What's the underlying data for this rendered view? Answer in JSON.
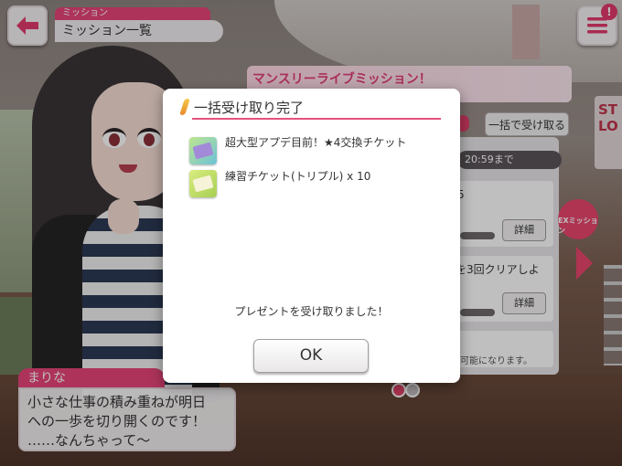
{
  "header": {
    "section_tag": "ミッション",
    "title": "ミッション一覧"
  },
  "menu_badge": "!",
  "mission_panel": {
    "banner": "マンスリーライブミッション！",
    "collect_all": "一括で受け取る",
    "deadline": "20:59まで",
    "cards": [
      {
        "text": "5",
        "detail": "詳細"
      },
      {
        "text": "を3回クリアしよ",
        "detail": "詳細"
      },
      {
        "text": "可能になります。",
        "detail": ""
      }
    ],
    "ex_label": "EXミッション"
  },
  "speech": {
    "speaker": "まりな",
    "lines": [
      "小さな仕事の積み重ねが明日",
      "への一歩を切り開くのです！",
      "……なんちゃって〜"
    ]
  },
  "modal": {
    "title": "一括受け取り完了",
    "rewards": [
      {
        "label": "超大型アプデ目前！★4交換チケット",
        "icon": "ticket-icon"
      },
      {
        "label": "練習チケット(トリプル) x 10",
        "icon": "practice-ticket-icon"
      }
    ],
    "message": "プレゼントを受け取りました！",
    "ok_label": "OK"
  },
  "colors": {
    "accent": "#e7457a",
    "modal_rule": "#e5527f"
  }
}
